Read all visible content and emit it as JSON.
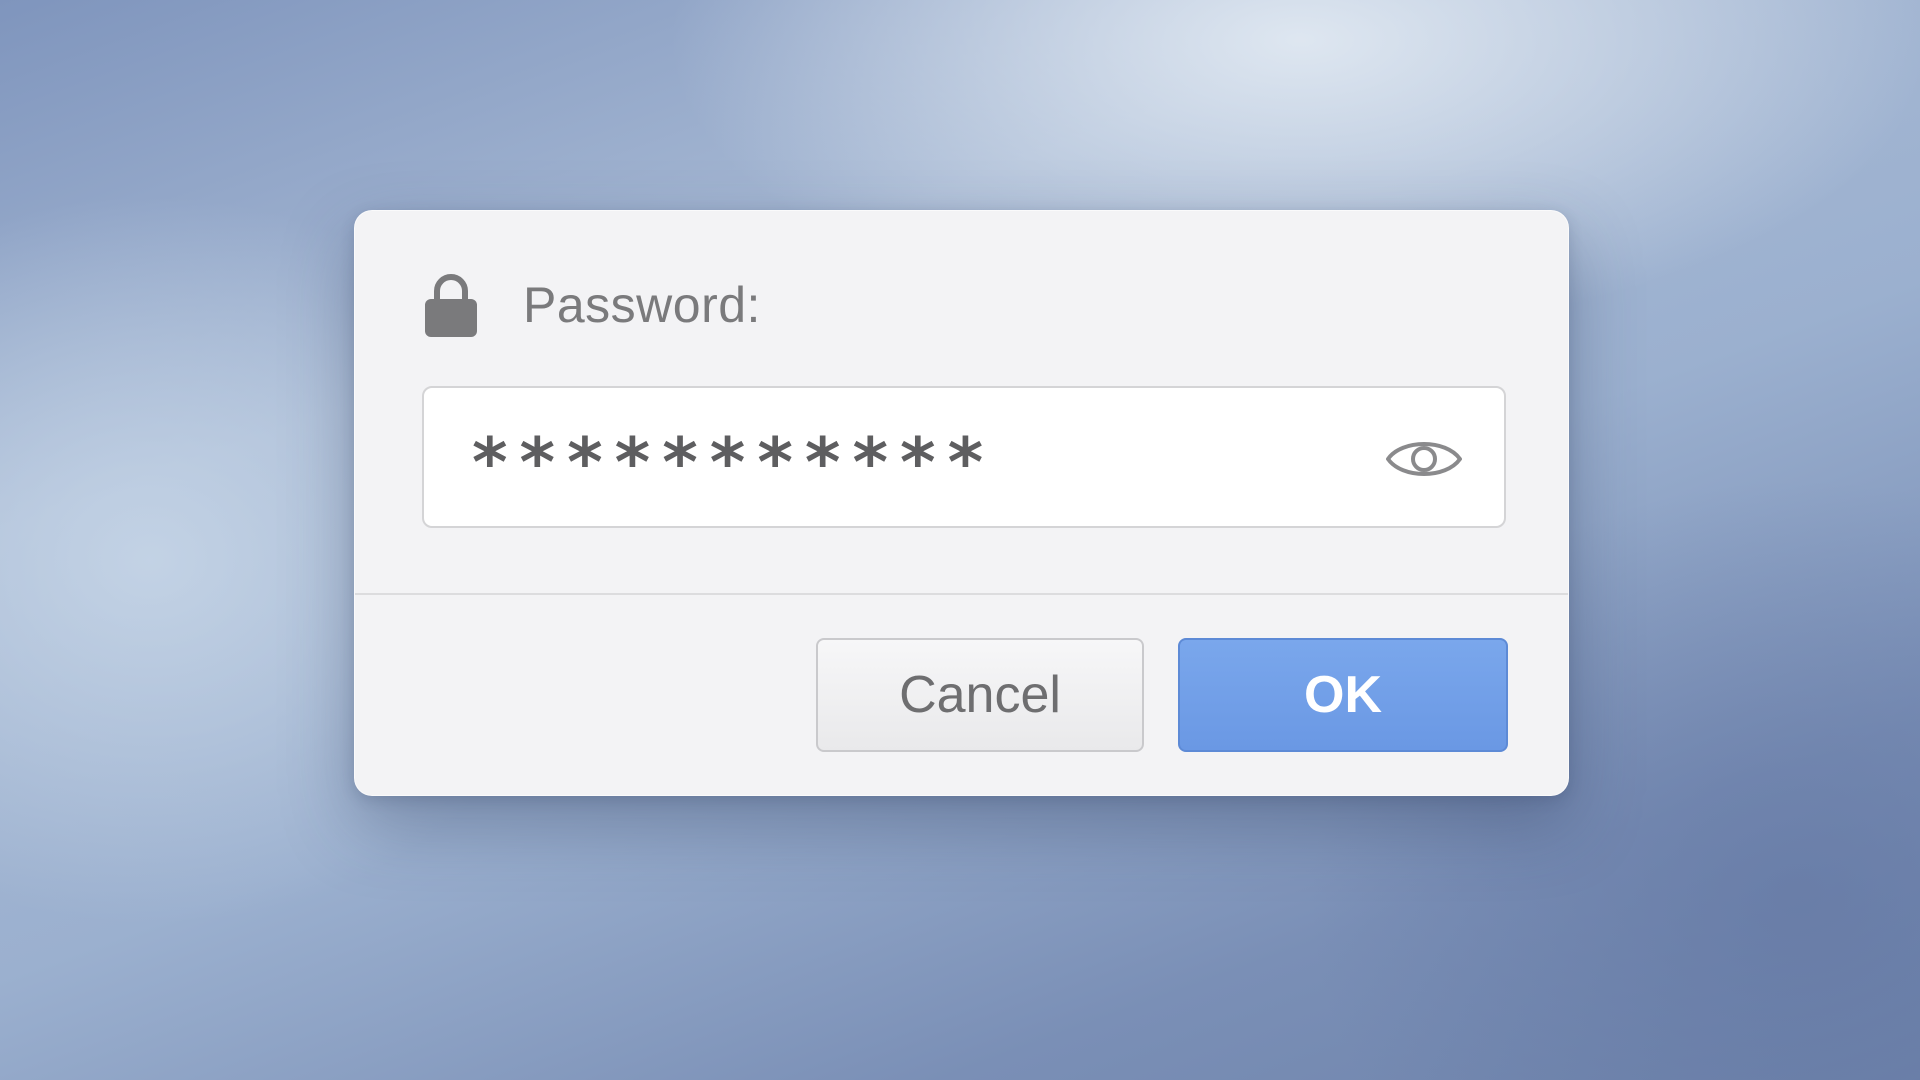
{
  "dialog": {
    "title": "Password:",
    "lock_icon": "lock-icon",
    "password_field": {
      "value": "***********",
      "reveal_icon": "eye-icon"
    },
    "buttons": {
      "cancel_label": "Cancel",
      "ok_label": "OK"
    }
  },
  "colors": {
    "accent": "#6e9be6",
    "dialog_background": "#f3f3f5",
    "text_gray": "#7a7a7c"
  }
}
